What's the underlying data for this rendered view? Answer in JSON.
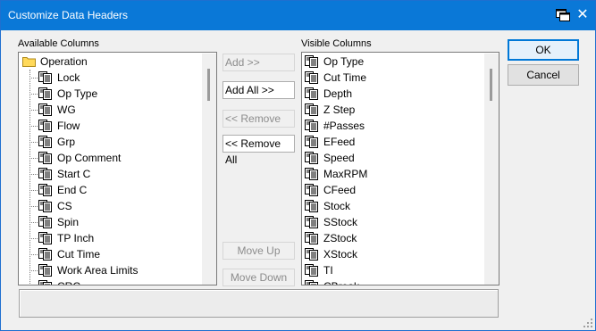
{
  "window": {
    "title": "Customize Data Headers",
    "title_icon": "window-icon",
    "close_glyph": "✕"
  },
  "available": {
    "label": "Available Columns",
    "root": "Operation",
    "items": [
      "Lock",
      "Op Type",
      "WG",
      "Flow",
      "Grp",
      "Op Comment",
      "Start C",
      "End C",
      "CS",
      "Spin",
      "TP Inch",
      "Cut Time",
      "Work Area Limits",
      "CRC"
    ]
  },
  "visible": {
    "label": "Visible Columns",
    "items": [
      "Op Type",
      "Cut Time",
      "Depth",
      "Z Step",
      "#Passes",
      "EFeed",
      "Speed",
      "MaxRPM",
      "CFeed",
      "Stock",
      "SStock",
      "ZStock",
      "XStock",
      "TI",
      "CBreak"
    ]
  },
  "buttons": {
    "add": "Add >>",
    "add_all": "Add All >>",
    "remove": "<< Remove",
    "remove_all": "<< Remove All",
    "move_up": "Move Up",
    "move_down": "Move Down",
    "ok": "OK",
    "cancel": "Cancel"
  },
  "status_text": ""
}
